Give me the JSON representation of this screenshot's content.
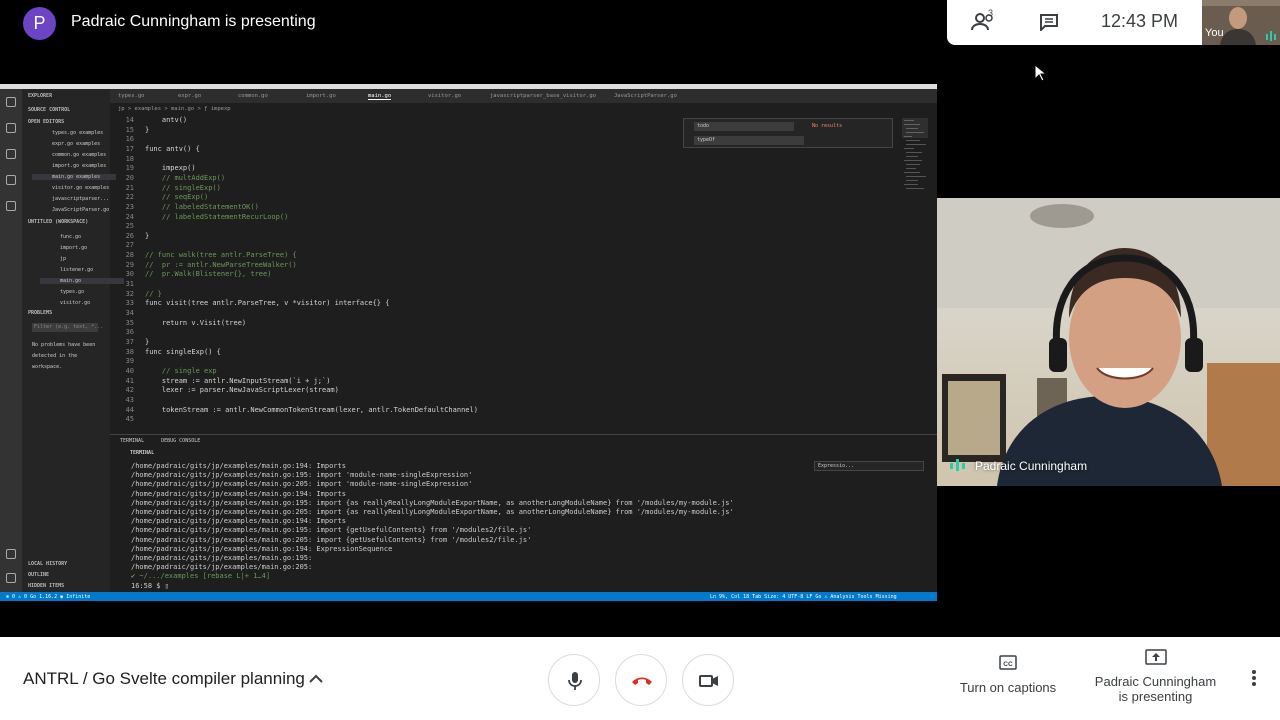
{
  "top": {
    "presenter_initial": "P",
    "presenter_title": "Padraic Cunningham is presenting",
    "people_count": "3",
    "time": "12:43 PM",
    "self_label": "You"
  },
  "ide": {
    "sidebar": {
      "explorer": "EXPLORER",
      "source_control": "SOURCE CONTROL",
      "open_editors": "OPEN EDITORS",
      "open_files": [
        "types.go examples",
        "expr.go examples",
        "common.go examples",
        "import.go examples",
        "main.go examples",
        "visitor.go examples",
        "javascriptparser...",
        "JavaScriptParser.go"
      ],
      "workspace": "UNTITLED (WORKSPACE)",
      "workspace_files": [
        "func.go",
        "import.go",
        "jp",
        "listener.go",
        "main.go",
        "types.go",
        "visitor.go"
      ],
      "problems": "PROBLEMS",
      "filter_placeholder": "Filter (e.g. text, *...",
      "no_problems": [
        "No problems have been",
        "detected in the",
        "workspace."
      ],
      "local_history": "LOCAL HISTORY",
      "outline": "OUTLINE",
      "hidden_items": "HIDDEN ITEMS"
    },
    "tabs": [
      "types.go",
      "expr.go",
      "common.go",
      "import.go",
      "main.go",
      "visitor.go",
      "javascriptparser_base_visitor.go",
      "JavaScriptParser.go"
    ],
    "breadcrumb": "jp > examples > main.go > ƒ impexp",
    "find": {
      "query": "todo",
      "replace": "typeOf",
      "result": "No results"
    },
    "code_lines": [
      {
        "n": "14",
        "t": "    antv()",
        "c": ""
      },
      {
        "n": "15",
        "t": "}",
        "c": ""
      },
      {
        "n": "16",
        "t": "",
        "c": ""
      },
      {
        "n": "17",
        "t": "func antv() {",
        "c": ""
      },
      {
        "n": "18",
        "t": "",
        "c": ""
      },
      {
        "n": "19",
        "t": "    impexp()",
        "c": ""
      },
      {
        "n": "20",
        "t": "    // multAddExp()",
        "c": "cm"
      },
      {
        "n": "21",
        "t": "    // singleExp()",
        "c": "cm"
      },
      {
        "n": "22",
        "t": "    // seqExp()",
        "c": "cm"
      },
      {
        "n": "23",
        "t": "    // labeledStatementOK()",
        "c": "cm"
      },
      {
        "n": "24",
        "t": "    // labeledStatementRecurLoop()",
        "c": "cm"
      },
      {
        "n": "25",
        "t": "",
        "c": ""
      },
      {
        "n": "26",
        "t": "}",
        "c": ""
      },
      {
        "n": "27",
        "t": "",
        "c": ""
      },
      {
        "n": "28",
        "t": "// func walk(tree antlr.ParseTree) {",
        "c": "cm"
      },
      {
        "n": "29",
        "t": "//  pr := antlr.NewParseTreeWalker()",
        "c": "cm"
      },
      {
        "n": "30",
        "t": "//  pr.Walk(Blistener{}, tree)",
        "c": "cm"
      },
      {
        "n": "31",
        "t": "",
        "c": ""
      },
      {
        "n": "32",
        "t": "// }",
        "c": "cm"
      },
      {
        "n": "33",
        "t": "func visit(tree antlr.ParseTree, v *visitor) interface{} {",
        "c": ""
      },
      {
        "n": "34",
        "t": "",
        "c": ""
      },
      {
        "n": "35",
        "t": "    return v.Visit(tree)",
        "c": ""
      },
      {
        "n": "36",
        "t": "",
        "c": ""
      },
      {
        "n": "37",
        "t": "}",
        "c": ""
      },
      {
        "n": "38",
        "t": "func singleExp() {",
        "c": ""
      },
      {
        "n": "39",
        "t": "",
        "c": ""
      },
      {
        "n": "40",
        "t": "    // single exp",
        "c": "cm"
      },
      {
        "n": "41",
        "t": "    stream := antlr.NewInputStream(`i + j;`)",
        "c": ""
      },
      {
        "n": "42",
        "t": "    lexer := parser.NewJavaScriptLexer(stream)",
        "c": ""
      },
      {
        "n": "43",
        "t": "",
        "c": ""
      },
      {
        "n": "44",
        "t": "    tokenStream := antlr.NewCommonTokenStream(lexer, antlr.TokenDefaultChannel)",
        "c": ""
      },
      {
        "n": "45",
        "t": "",
        "c": ""
      }
    ],
    "panel_tabs": [
      "TERMINAL",
      "DEBUG CONSOLE"
    ],
    "terminal_title": "TERMINAL",
    "terminal_find": "Expressio...",
    "terminal_lines": [
      "/home/padraic/gits/jp/examples/main.go:194: Imports",
      "/home/padraic/gits/jp/examples/main.go:195: import 'module-name-singleExpression'",
      "/home/padraic/gits/jp/examples/main.go:205: import 'module-name-singleExpression'",
      "/home/padraic/gits/jp/examples/main.go:194: Imports",
      "/home/padraic/gits/jp/examples/main.go:195: import {as reallyReallyLongModuleExportName, as anotherLongModuleName} from '/modules/my-module.js'",
      "/home/padraic/gits/jp/examples/main.go:205: import {as reallyReallyLongModuleExportName, as anotherLongModuleName} from '/modules/my-module.js'",
      "/home/padraic/gits/jp/examples/main.go:194: Imports",
      "/home/padraic/gits/jp/examples/main.go:195: import {getUsefulContents} from '/modules2/file.js'",
      "/home/padraic/gits/jp/examples/main.go:205: import {getUsefulContents} from '/modules2/file.js'",
      "/home/padraic/gits/jp/examples/main.go:194: ExpressionSequence",
      "/home/padraic/gits/jp/examples/main.go:195:",
      "/home/padraic/gits/jp/examples/main.go:205:",
      "✔ ~/.../examples [rebase L|+ 1…4]",
      "16:58 $ ▯"
    ],
    "status": {
      "left": "⊗ 0 ⚠ 0   Go 1.16.2   ◉ Infinite",
      "right": "Ln 9%, Col 18   Tab Size: 4   UTF-8   LF   Go   ⚠ Analysis Tools Missing"
    }
  },
  "camera": {
    "name": "Padraic Cunningham"
  },
  "bottom": {
    "meeting_name": "ANTRL / Go Svelte compiler planning",
    "captions": "Turn on captions",
    "presenting_line1": "Padraic Cunningham",
    "presenting_line2": "is presenting"
  }
}
